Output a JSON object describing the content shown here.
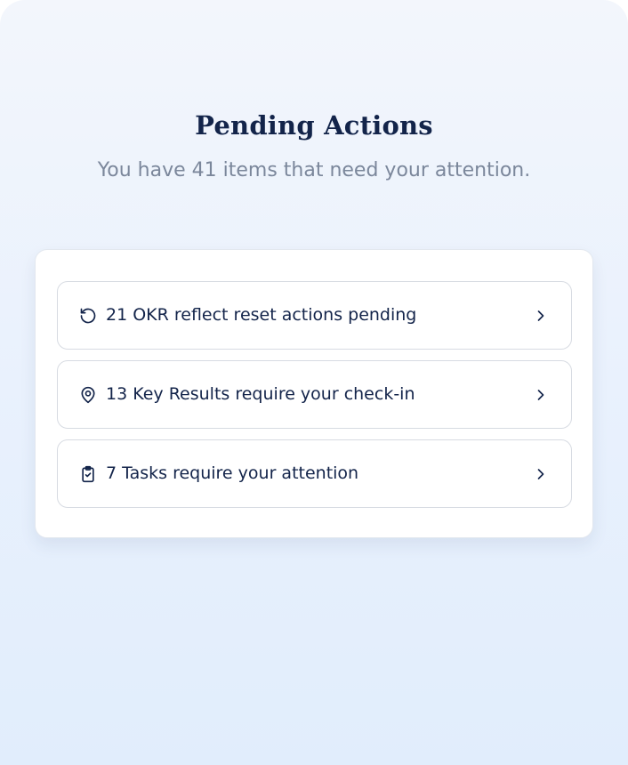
{
  "header": {
    "title": "Pending Actions",
    "subtitle": "You have 41 items that need your attention."
  },
  "actions": [
    {
      "label": "21 OKR reflect reset actions pending",
      "icon": "refresh-icon"
    },
    {
      "label": "13 Key Results require your check-in",
      "icon": "map-pin-icon"
    },
    {
      "label": "7 Tasks require your attention",
      "icon": "clipboard-check-icon"
    }
  ],
  "colors": {
    "text_primary": "#13244a",
    "text_secondary": "#7b879b",
    "background_top": "#f3f6fc",
    "background_bottom": "#e1edfc",
    "border": "#d7dbe2"
  }
}
